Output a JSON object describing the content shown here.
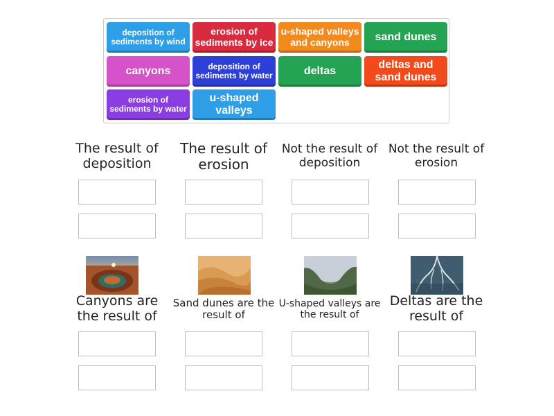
{
  "tiles": [
    {
      "label": "deposition of sediments by wind",
      "color": "#2e9ee6"
    },
    {
      "label": "erosion of sediments by ice",
      "color": "#d92b3f"
    },
    {
      "label": "u-shaped valleys and canyons",
      "color": "#f28a1e"
    },
    {
      "label": "sand dunes",
      "color": "#24a352"
    },
    {
      "label": "canyons",
      "color": "#d552c8"
    },
    {
      "label": "deposition of sediments by water",
      "color": "#2c3fd6"
    },
    {
      "label": "deltas",
      "color": "#24a352"
    },
    {
      "label": "deltas and sand dunes",
      "color": "#f24a1a"
    },
    {
      "label": "erosion of sediments by water",
      "color": "#8a3de0"
    },
    {
      "label": "u-shaped valleys",
      "color": "#2e9ee6"
    }
  ],
  "columns": [
    {
      "heading": "The result of deposition"
    },
    {
      "heading": "The result of erosion"
    },
    {
      "heading": "Not the result of deposition"
    },
    {
      "heading": "Not the result of erosion"
    }
  ],
  "image_items": [
    {
      "caption": "Canyons are the result of",
      "image": "canyon-photo"
    },
    {
      "caption": "Sand dunes are the result of",
      "image": "sand-dunes-photo"
    },
    {
      "caption": "U-shaped valleys are the result of",
      "image": "u-shaped-valley-photo"
    },
    {
      "caption": "Deltas are the result of",
      "image": "delta-photo"
    }
  ]
}
